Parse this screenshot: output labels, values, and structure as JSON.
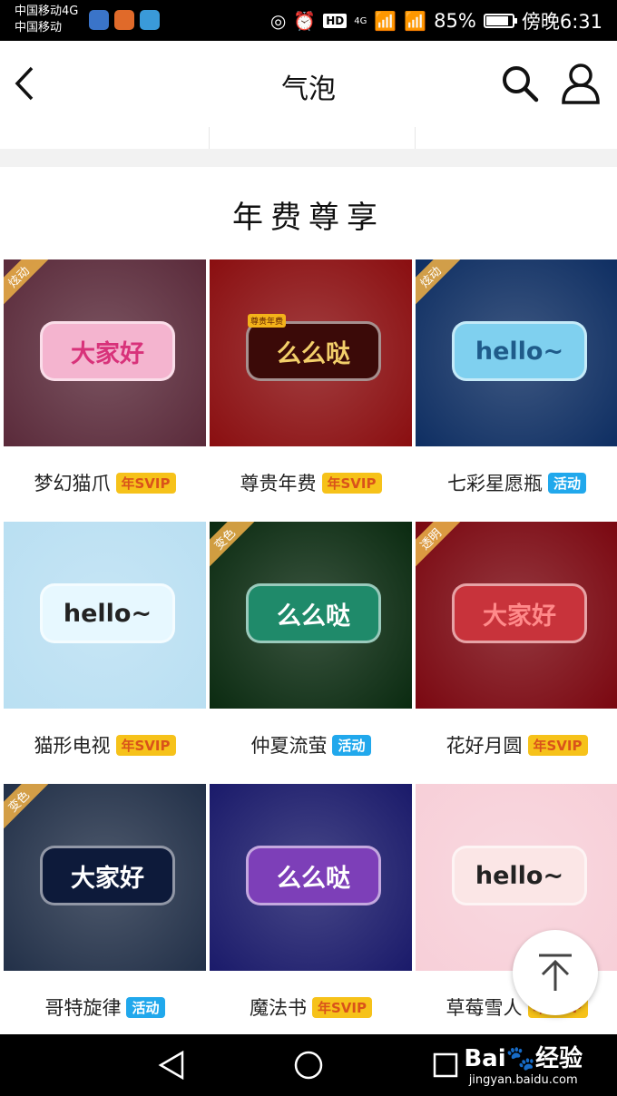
{
  "status_bar": {
    "carrier1": "中国移动4G",
    "carrier2": "中国移动",
    "hd": "HD",
    "net1": "4G",
    "battery": "85%",
    "time": "傍晚6:31",
    "battery_level": 0.85
  },
  "nav": {
    "title": "气泡"
  },
  "section": {
    "title": "年费尊享"
  },
  "items": [
    {
      "name": "梦幻猫爪",
      "tag": "年SVIP",
      "tag_type": "vip",
      "ribbon": "炫动",
      "bubble_text": "大家好",
      "bg": "#5a2a3a",
      "bubble_bg": "#f4b4cf",
      "bubble_fg": "#d8327a"
    },
    {
      "name": "尊贵年费",
      "tag": "年SVIP",
      "tag_type": "vip",
      "ribbon": "",
      "badge": "尊贵年费",
      "bubble_text": "么么哒",
      "bg": "#8a0e10",
      "bubble_bg": "#3b0a08",
      "bubble_fg": "#f3cf6a"
    },
    {
      "name": "七彩星愿瓶",
      "tag": "活动",
      "tag_type": "act",
      "ribbon": "炫动",
      "bubble_text": "hello~",
      "bg": "#0e2e62",
      "bubble_bg": "#7fd0ef",
      "bubble_fg": "#1f5b8a"
    },
    {
      "name": "猫形电视",
      "tag": "年SVIP",
      "tag_type": "vip",
      "ribbon": "",
      "bubble_text": "hello~",
      "bg": "#b9dff2",
      "bubble_bg": "#e7f8ff",
      "bubble_fg": "#222222"
    },
    {
      "name": "仲夏流萤",
      "tag": "活动",
      "tag_type": "act",
      "ribbon": "变色",
      "bubble_text": "么么哒",
      "bg": "#0a2a10",
      "bubble_bg": "#1f8a6a",
      "bubble_fg": "#ffffff"
    },
    {
      "name": "花好月圆",
      "tag": "年SVIP",
      "tag_type": "vip",
      "ribbon": "透明",
      "bubble_text": "大家好",
      "bg": "#7a0710",
      "bubble_bg": "#c8333b",
      "bubble_fg": "#ff8a8a"
    },
    {
      "name": "哥特旋律",
      "tag": "活动",
      "tag_type": "act",
      "ribbon": "变色",
      "bubble_text": "大家好",
      "bg": "#223048",
      "bubble_bg": "#0d1a3a",
      "bubble_fg": "#ffffff"
    },
    {
      "name": "魔法书",
      "tag": "年SVIP",
      "tag_type": "vip",
      "ribbon": "",
      "bubble_text": "么么哒",
      "bg": "#1a1a6a",
      "bubble_bg": "#7d3fb8",
      "bubble_fg": "#ffffff"
    },
    {
      "name": "草莓雪人",
      "tag": "年SVIP",
      "tag_type": "vip",
      "ribbon": "",
      "bubble_text": "hello~",
      "bg": "#f7cfd8",
      "bubble_bg": "#fbe6e6",
      "bubble_fg": "#222222"
    }
  ],
  "watermark": {
    "brand": "Bai🐾经验",
    "url": "jingyan.baidu.com"
  }
}
